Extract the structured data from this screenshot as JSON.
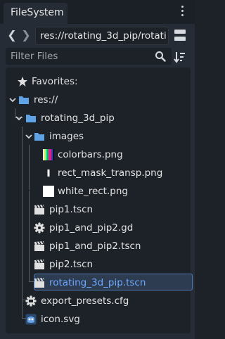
{
  "dock": {
    "tab_label": "FileSystem",
    "path": "res://rotating_3d_pip/rotati",
    "filter_placeholder": "Filter Files"
  },
  "tree": {
    "favorites_label": "Favorites:",
    "root_label": "res://",
    "folder_label": "rotating_3d_pip",
    "images_label": "images",
    "files": {
      "colorbars": "colorbars.png",
      "rect_mask": "rect_mask_transp.png",
      "white_rect": "white_rect.png",
      "pip1_tscn": "pip1.tscn",
      "pip1_and_pip2_gd": "pip1_and_pip2.gd",
      "pip1_and_pip2_tscn": "pip1_and_pip2.tscn",
      "pip2_tscn": "pip2.tscn",
      "rotating_tscn": "rotating_3d_pip.tscn",
      "export_presets": "export_presets.cfg",
      "icon_svg": "icon.svg"
    },
    "selected": "rotating_3d_pip.tscn"
  },
  "colors": {
    "folder": "#5fa2e6",
    "selection_border": "#4d7cb8",
    "selection_text": "#6fa9ff"
  }
}
